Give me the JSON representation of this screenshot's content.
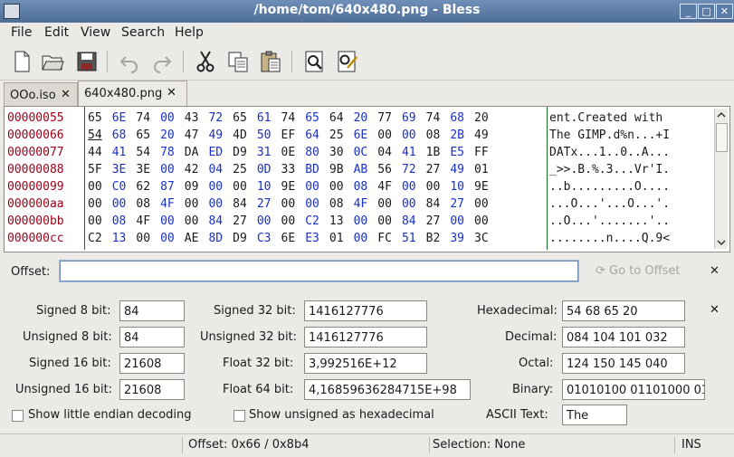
{
  "window": {
    "title": "/home/tom/640x480.png - Bless",
    "minimize": "_",
    "maximize": "□",
    "close": "✕"
  },
  "menubar": {
    "file": "File",
    "edit": "Edit",
    "view": "View",
    "search": "Search",
    "help": "Help"
  },
  "toolbar": {
    "icons": [
      "new-file-icon",
      "open-folder-icon",
      "save-icon",
      "undo-icon",
      "redo-icon",
      "cut-icon",
      "copy-icon",
      "paste-icon",
      "find-icon",
      "find-replace-icon"
    ]
  },
  "tabs": [
    {
      "label": "OOo.iso",
      "close": "✕"
    },
    {
      "label": "640x480.png",
      "close": "✕"
    }
  ],
  "hexview": {
    "offsets": [
      "00000055",
      "00000066",
      "00000077",
      "00000088",
      "00000099",
      "000000aa",
      "000000bb",
      "000000cc"
    ],
    "rows": [
      [
        "65",
        "6E",
        "74",
        "00",
        "43",
        "72",
        "65",
        "61",
        "74",
        "65",
        "64",
        "20",
        "77",
        "69",
        "74",
        "68",
        "20"
      ],
      [
        "54",
        "68",
        "65",
        "20",
        "47",
        "49",
        "4D",
        "50",
        "EF",
        "64",
        "25",
        "6E",
        "00",
        "00",
        "08",
        "2B",
        "49"
      ],
      [
        "44",
        "41",
        "54",
        "78",
        "DA",
        "ED",
        "D9",
        "31",
        "0E",
        "80",
        "30",
        "0C",
        "04",
        "41",
        "1B",
        "E5",
        "FF"
      ],
      [
        "5F",
        "3E",
        "3E",
        "00",
        "42",
        "04",
        "25",
        "0D",
        "33",
        "BD",
        "9B",
        "AB",
        "56",
        "72",
        "27",
        "49",
        "01"
      ],
      [
        "00",
        "C0",
        "62",
        "87",
        "09",
        "00",
        "00",
        "10",
        "9E",
        "00",
        "00",
        "08",
        "4F",
        "00",
        "00",
        "10",
        "9E"
      ],
      [
        "00",
        "00",
        "08",
        "4F",
        "00",
        "00",
        "84",
        "27",
        "00",
        "00",
        "08",
        "4F",
        "00",
        "00",
        "84",
        "27",
        "00"
      ],
      [
        "00",
        "08",
        "4F",
        "00",
        "00",
        "84",
        "27",
        "00",
        "00",
        "C2",
        "13",
        "00",
        "00",
        "84",
        "27",
        "00",
        "00"
      ],
      [
        "C2",
        "13",
        "00",
        "00",
        "AE",
        "8D",
        "D9",
        "C3",
        "6E",
        "E3",
        "01",
        "00",
        "FC",
        "51",
        "B2",
        "39",
        "3C"
      ]
    ],
    "ascii": [
      "ent.Created with ",
      "The GIMP.d%n...+I",
      "DATx...1..0..A...",
      "_>>.B.%.3...Vr'I.",
      "..b.........O....",
      "...O...'...O...'.",
      "..O...'.......'..",
      "........n....Q.9<"
    ],
    "colors": {
      "offset": "#a00018",
      "blue": "#1830c8",
      "black": "#1a1a1a",
      "divider": "#1e6e1e"
    }
  },
  "offsetbar": {
    "label": "Offset:",
    "value": "",
    "goto": "Go to Offset",
    "close": "✕"
  },
  "conversion": {
    "s8_label": "Signed 8 bit:",
    "s8": "84",
    "u8_label": "Unsigned 8 bit:",
    "u8": "84",
    "s16_label": "Signed 16 bit:",
    "s16": "21608",
    "u16_label": "Unsigned 16 bit:",
    "u16": "21608",
    "s32_label": "Signed 32 bit:",
    "s32": "1416127776",
    "u32_label": "Unsigned 32 bit:",
    "u32": "1416127776",
    "f32_label": "Float 32 bit:",
    "f32": "3,992516E+12",
    "f64_label": "Float 64 bit:",
    "f64": "4,16859636284715E+98",
    "hex_label": "Hexadecimal:",
    "hex": "54 68 65 20",
    "dec_label": "Decimal:",
    "dec": "084 104 101 032",
    "oct_label": "Octal:",
    "oct": "124 150 145 040",
    "bin_label": "Binary:",
    "bin": "01010100 01101000 01",
    "ascii_label": "ASCII Text:",
    "ascii": "The",
    "little_endian": "Show little endian decoding",
    "unsigned_hex": "Show unsigned as hexadecimal",
    "close": "✕"
  },
  "status": {
    "offset": "Offset: 0x66 / 0x8b4",
    "selection": "Selection: None",
    "mode": "INS"
  }
}
